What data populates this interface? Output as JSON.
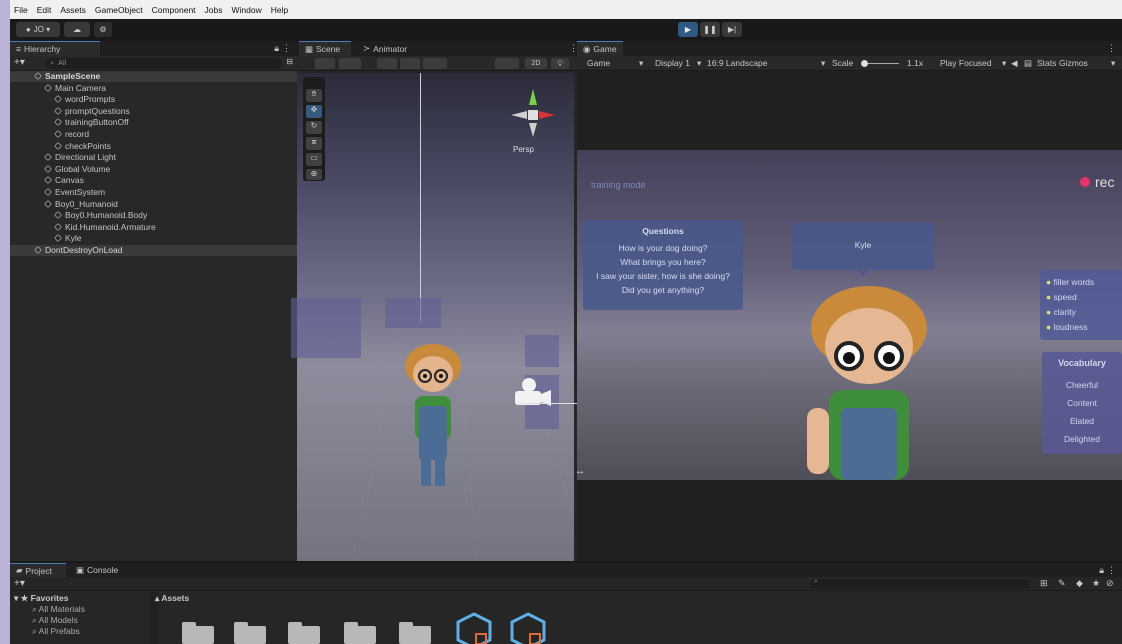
{
  "menu": [
    "File",
    "Edit",
    "Assets",
    "GameObject",
    "Component",
    "Jobs",
    "Window",
    "Help"
  ],
  "account": "JO ▾",
  "hierarchy": {
    "title": "Hierarchy",
    "search": "All",
    "items": [
      {
        "label": "SampleScene",
        "depth": 0,
        "kind": "scene"
      },
      {
        "label": "Main Camera",
        "depth": 1
      },
      {
        "label": "wordPrompts",
        "depth": 2
      },
      {
        "label": "promptQuestions",
        "depth": 2
      },
      {
        "label": "trainingButtonOff",
        "depth": 2
      },
      {
        "label": "record",
        "depth": 2
      },
      {
        "label": "checkPoints",
        "depth": 2
      },
      {
        "label": "Directional Light",
        "depth": 1
      },
      {
        "label": "Global Volume",
        "depth": 1
      },
      {
        "label": "Canvas",
        "depth": 1
      },
      {
        "label": "EventSystem",
        "depth": 1
      },
      {
        "label": "Boy0_Humanoid",
        "depth": 1
      },
      {
        "label": "Boy0.Humanoid.Body",
        "depth": 2
      },
      {
        "label": "Kid.Humanoid.Armature",
        "depth": 2
      },
      {
        "label": "Kyle",
        "depth": 2
      },
      {
        "label": "DontDestroyOnLoad",
        "depth": 0,
        "kind": "dont"
      }
    ]
  },
  "scene_tabs": [
    "Scene",
    "Animator"
  ],
  "scene_toolbar": {
    "mode2d": "2D",
    "persp": "Persp"
  },
  "game": {
    "tab": "Game",
    "display_mode": "Game",
    "display": "Display 1",
    "aspect": "16:9 Landscape",
    "scale_label": "Scale",
    "scale_value": "1.1x",
    "play_focused": "Play Focused",
    "stats": "Stats",
    "gizmos": "Gizmos",
    "top_left": "training mode",
    "rec": "rec",
    "questions_title": "Questions",
    "questions": [
      "How is your dog doing?",
      "What brings you here?",
      "I saw your sister, how is she doing?",
      "Did you get anything?"
    ],
    "speaker": "Kyle",
    "checks": [
      "filler words",
      "speed",
      "clarity",
      "loudness"
    ],
    "vocab_title": "Vocabulary",
    "vocab": [
      "Cheerful",
      "Content",
      "Elated",
      "Delighted"
    ]
  },
  "bottom": {
    "tabs": [
      "Project",
      "Console"
    ],
    "favorites": "Favorites",
    "fav_items": [
      "All Materials",
      "All Models",
      "All Prefabs"
    ],
    "assets": "Assets"
  },
  "colors": {
    "accent": "#4a7dbd",
    "play": "#2e5a84"
  }
}
